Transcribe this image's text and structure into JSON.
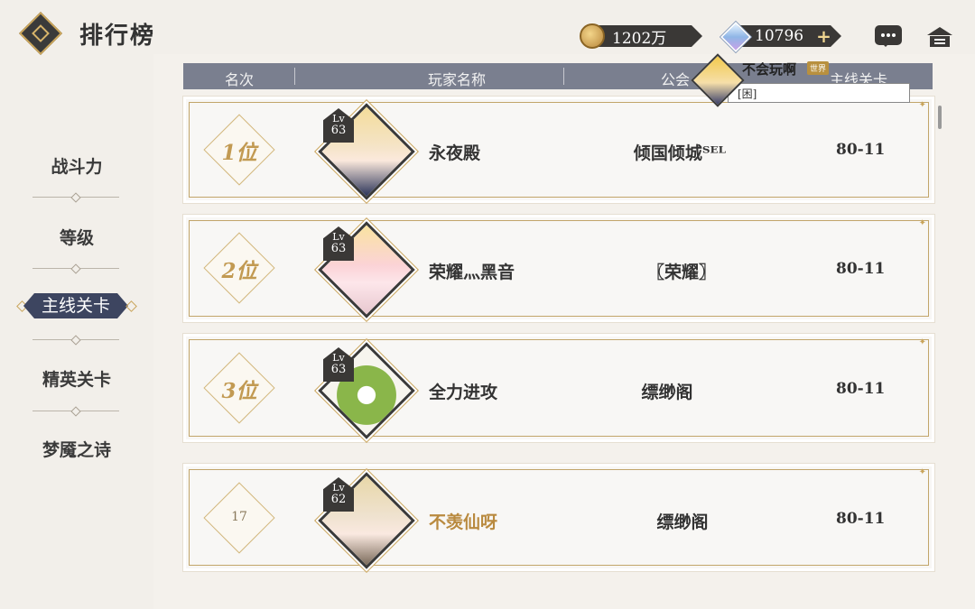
{
  "header": {
    "title": "排行榜",
    "gold": "1202万",
    "gems": "10796",
    "gems_add": "+"
  },
  "nav": {
    "items": [
      {
        "label": "战斗力",
        "active": false
      },
      {
        "label": "等级",
        "active": false
      },
      {
        "label": "主线关卡",
        "active": true
      },
      {
        "label": "精英关卡",
        "active": false
      },
      {
        "label": "梦魇之诗",
        "active": false
      }
    ]
  },
  "table": {
    "columns": [
      "名次",
      "玩家名称",
      "公会",
      "主线关卡"
    ],
    "rows": [
      {
        "rank": "1位",
        "level_prefix": "Lv",
        "level": "63",
        "name": "永夜殿",
        "guild": "倾国倾城ᵀᴱᴸ",
        "stage": "80-11",
        "is_self": false
      },
      {
        "rank": "2位",
        "level_prefix": "Lv",
        "level": "63",
        "name": "荣耀灬黑音",
        "guild": "〖荣耀〗",
        "stage": "80-11",
        "is_self": false
      },
      {
        "rank": "3位",
        "level_prefix": "Lv",
        "level": "63",
        "name": "全力进攻",
        "guild": "缥缈阁",
        "stage": "80-11",
        "is_self": false
      },
      {
        "rank": "17",
        "level_prefix": "Lv",
        "level": "62",
        "name": "不羡仙呀",
        "guild": "缥缈阁",
        "stage": "80-11",
        "is_self": true
      }
    ]
  },
  "chat_popup": {
    "sender": "不会玩啊",
    "channel": "世界",
    "message": "[困]"
  },
  "colors": {
    "accent_gold": "#c29a52",
    "header_bar": "#7a7f8f",
    "active_tab": "#3d4560",
    "self_name": "#b98a3f"
  }
}
